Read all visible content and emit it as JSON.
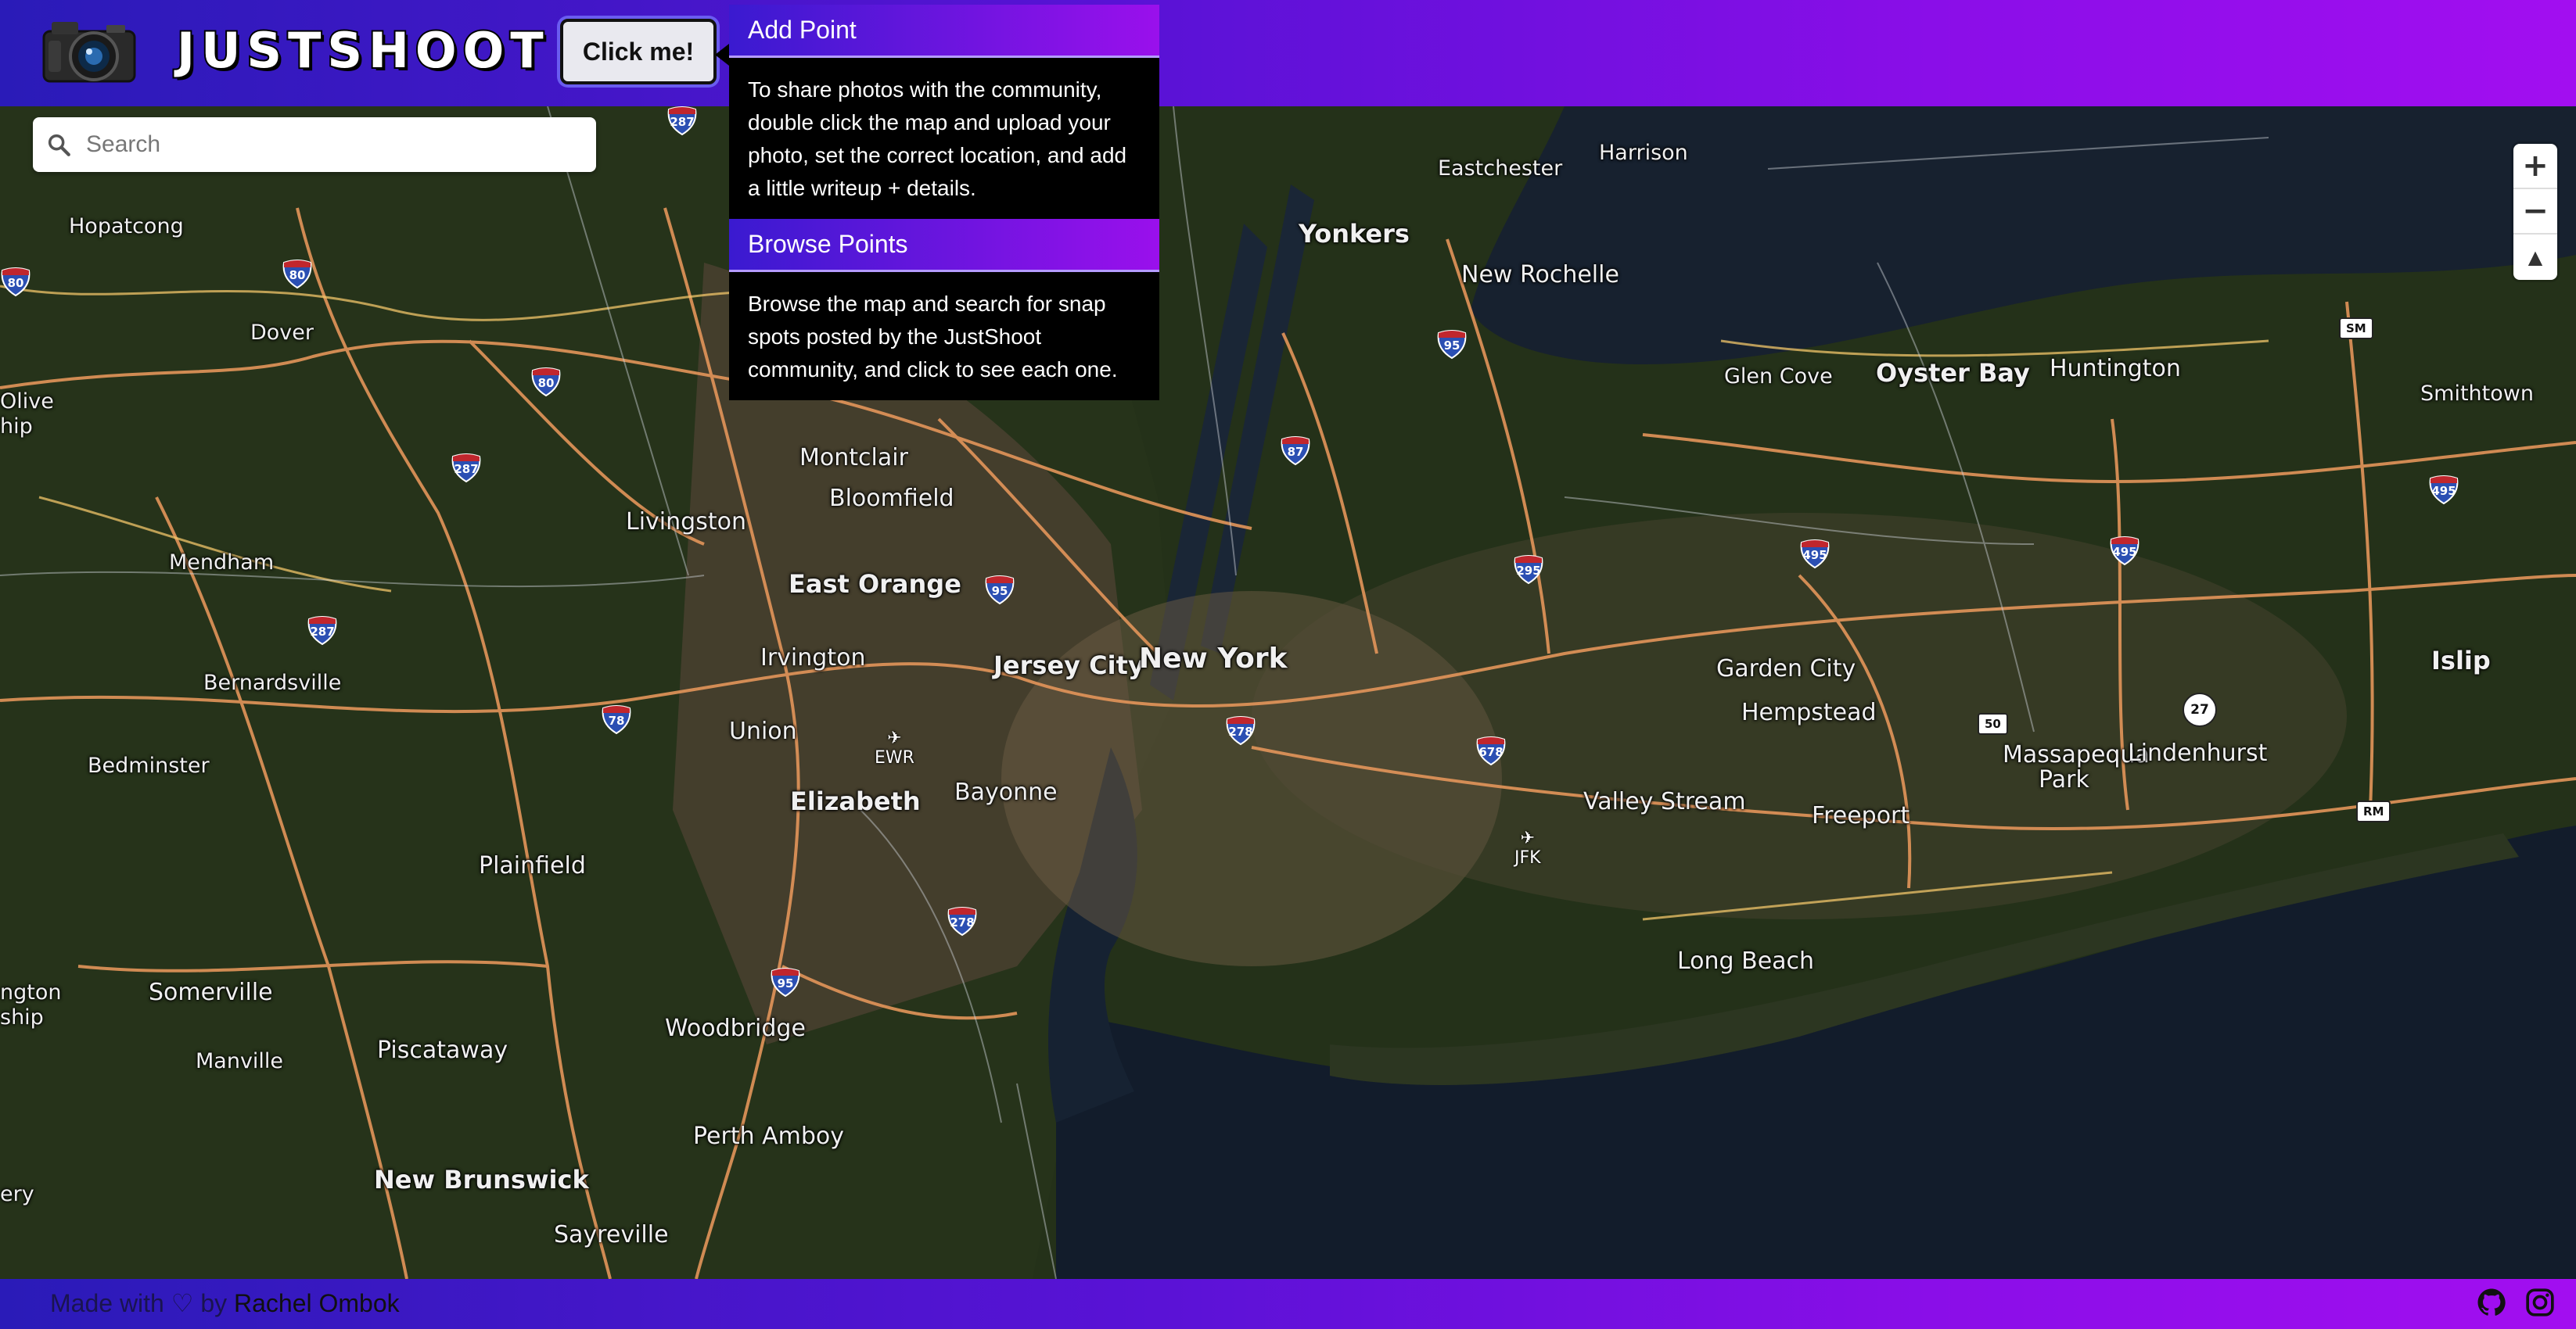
{
  "header": {
    "logo_text": "JUSTSHOOT",
    "click_button": "Click me!"
  },
  "search": {
    "placeholder": "Search"
  },
  "tooltip": {
    "add_title": "Add Point",
    "add_body": "To share photos with the community, double click the map and upload your photo, set the correct location, and add a little writeup + details.",
    "browse_title": "Browse Points",
    "browse_body": "Browse the map and search for snap spots posted by the JustShoot community, and click to see each one."
  },
  "zoom": {
    "zoom_in": "+",
    "zoom_out": "−",
    "compass": "▲"
  },
  "map": {
    "labels": [
      {
        "id": "hopatcong",
        "text": "Hopatcong"
      },
      {
        "id": "dover",
        "text": "Dover"
      },
      {
        "id": "olive",
        "text": "Olive"
      },
      {
        "id": "olive2",
        "text": "hip"
      },
      {
        "id": "mendham",
        "text": "Mendham"
      },
      {
        "id": "livingston",
        "text": "Livingston"
      },
      {
        "id": "montclair",
        "text": "Montclair"
      },
      {
        "id": "bloomfield",
        "text": "Bloomfield"
      },
      {
        "id": "east-orange",
        "text": "East Orange"
      },
      {
        "id": "bernardsville",
        "text": "Bernardsville"
      },
      {
        "id": "irvington",
        "text": "Irvington"
      },
      {
        "id": "jersey-city",
        "text": "Jersey City"
      },
      {
        "id": "new-york",
        "text": "New York"
      },
      {
        "id": "union",
        "text": "Union"
      },
      {
        "id": "bedminster",
        "text": "Bedminster"
      },
      {
        "id": "elizabeth",
        "text": "Elizabeth"
      },
      {
        "id": "bayonne",
        "text": "Bayonne"
      },
      {
        "id": "plainfield",
        "text": "Plainfield"
      },
      {
        "id": "somerville",
        "text": "Somerville"
      },
      {
        "id": "ngton",
        "text": "ngton"
      },
      {
        "id": "ship",
        "text": "ship"
      },
      {
        "id": "piscataway",
        "text": "Piscataway"
      },
      {
        "id": "manville",
        "text": "Manville"
      },
      {
        "id": "woodbridge",
        "text": "Woodbridge"
      },
      {
        "id": "perth-amboy",
        "text": "Perth Amboy"
      },
      {
        "id": "new-brunswick",
        "text": "New Brunswick"
      },
      {
        "id": "sayreville",
        "text": "Sayreville"
      },
      {
        "id": "ery",
        "text": "ery"
      },
      {
        "id": "eastchester",
        "text": "Eastchester"
      },
      {
        "id": "harrison",
        "text": "Harrison"
      },
      {
        "id": "yonkers",
        "text": "Yonkers"
      },
      {
        "id": "new-rochelle",
        "text": "New Rochelle"
      },
      {
        "id": "glen-cove",
        "text": "Glen Cove"
      },
      {
        "id": "oyster-bay",
        "text": "Oyster Bay"
      },
      {
        "id": "huntington",
        "text": "Huntington"
      },
      {
        "id": "smithtown",
        "text": "Smithtown"
      },
      {
        "id": "garden-city",
        "text": "Garden City"
      },
      {
        "id": "hempstead",
        "text": "Hempstead"
      },
      {
        "id": "valley-stream",
        "text": "Valley Stream"
      },
      {
        "id": "freeport",
        "text": "Freeport"
      },
      {
        "id": "massapequa",
        "text": "Massapequa"
      },
      {
        "id": "park",
        "text": "Park"
      },
      {
        "id": "lindenhurst",
        "text": "Lindenhurst"
      },
      {
        "id": "islip",
        "text": "Islip"
      },
      {
        "id": "long-beach",
        "text": "Long Beach"
      }
    ],
    "shields": [
      {
        "id": "i80a",
        "text": "80"
      },
      {
        "id": "i80b",
        "text": "80"
      },
      {
        "id": "i80c",
        "text": "80"
      },
      {
        "id": "i287a",
        "text": "287"
      },
      {
        "id": "i287b",
        "text": "287"
      },
      {
        "id": "i287c",
        "text": "287"
      },
      {
        "id": "i78",
        "text": "78"
      },
      {
        "id": "i95a",
        "text": "95"
      },
      {
        "id": "i95b",
        "text": "95"
      },
      {
        "id": "i95c",
        "text": "95"
      },
      {
        "id": "i87",
        "text": "87"
      },
      {
        "id": "i278a",
        "text": "278"
      },
      {
        "id": "i278b",
        "text": "278"
      },
      {
        "id": "i295",
        "text": "295"
      },
      {
        "id": "i678",
        "text": "678"
      },
      {
        "id": "i495a",
        "text": "495"
      },
      {
        "id": "i495b",
        "text": "495"
      },
      {
        "id": "i495c",
        "text": "495"
      }
    ],
    "badges": {
      "sm": "SM",
      "rm": "RM",
      "s50": "50",
      "r27": "27"
    },
    "airports": {
      "ewr": "EWR",
      "jfk": "JFK"
    }
  },
  "footer": {
    "made_with": "Made with ♡ by ",
    "author": "Rachel Ombok"
  }
}
